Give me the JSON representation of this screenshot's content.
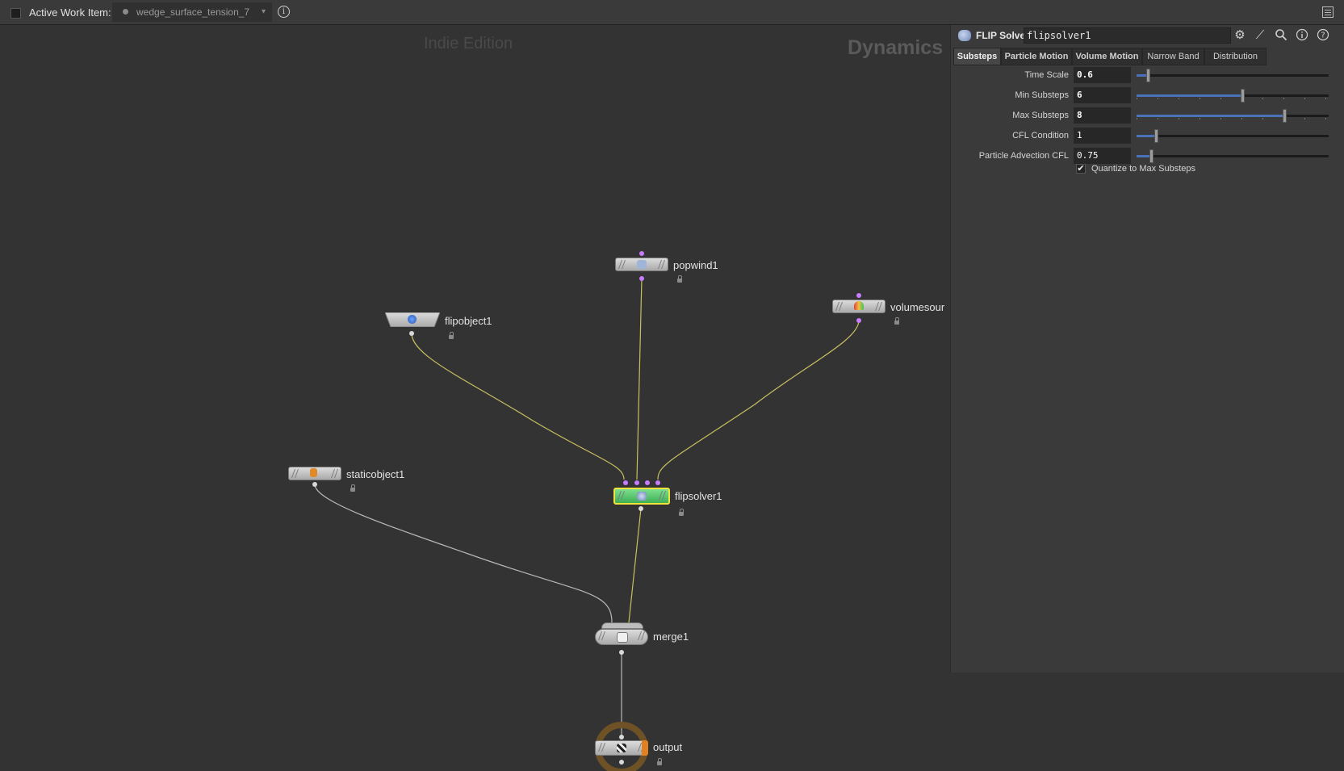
{
  "topbar": {
    "active_work_item_label": "Active Work Item:",
    "work_item_name": "wedge_surface_tension_7",
    "dropdown_glyph": "▾",
    "info_glyph": "i"
  },
  "network": {
    "edition_watermark": "Indie Edition",
    "context_watermark": "Dynamics",
    "nodes": {
      "popwind": "popwind1",
      "flipobject": "flipobject1",
      "volumesource": "volumesour",
      "staticobject": "staticobject1",
      "flipsolver": "flipsolver1",
      "merge": "merge1",
      "output": "output"
    }
  },
  "panel": {
    "node_type": "FLIP Solver",
    "node_name": "flipsolver1",
    "tool_icons": [
      "gear-icon",
      "brush-icon",
      "search-icon",
      "info-icon",
      "help-icon"
    ],
    "tabs": [
      "Substeps",
      "Particle Motion",
      "Volume Motion",
      "Narrow Band",
      "Distribution"
    ],
    "active_tab": "Substeps",
    "parms": [
      {
        "label": "Time Scale",
        "value": "0.6",
        "slider_fraction": 0.06
      },
      {
        "label": "Min Substeps",
        "value": "6",
        "slider_fraction": 0.55
      },
      {
        "label": "Max Substeps",
        "value": "8",
        "slider_fraction": 0.77
      },
      {
        "label": "CFL Condition",
        "value": "1",
        "slider_fraction": 0.1
      },
      {
        "label": "Particle Advection CFL",
        "value": "0.75",
        "slider_fraction": 0.075
      }
    ],
    "quantize": {
      "label": "Quantize to Max Substeps",
      "checked": true,
      "glyph": "✔"
    }
  },
  "colors": {
    "wire_yellow": "#c8c060",
    "wire_gray": "#b8b8b8",
    "selected_node": "#5fd07a",
    "selected_outline": "#f2e33a",
    "input_dot": "#c77cff",
    "slider_fill": "#4a72b8",
    "output_ring": "#7a5a2a"
  }
}
